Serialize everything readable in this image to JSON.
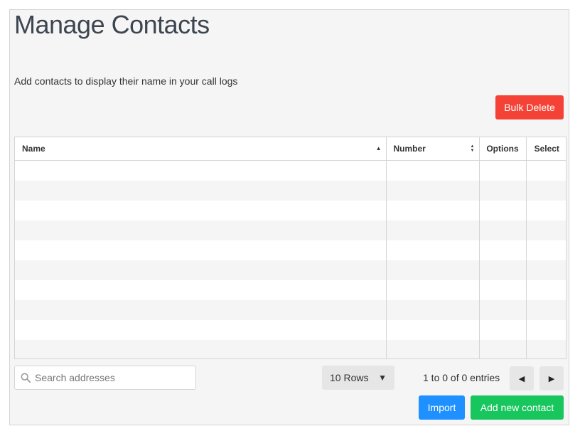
{
  "page": {
    "title": "Manage Contacts",
    "subtitle": "Add contacts to display their name in your call logs"
  },
  "actions": {
    "bulk_delete_label": "Bulk Delete",
    "import_label": "Import",
    "add_contact_label": "Add new contact"
  },
  "table": {
    "columns": [
      {
        "label": "Name",
        "sort": "ascending"
      },
      {
        "label": "Number",
        "sort": "sortable"
      },
      {
        "label": "Options",
        "sort": "none"
      },
      {
        "label": "Select",
        "sort": "none"
      }
    ],
    "rows": []
  },
  "footer": {
    "search_placeholder": "Search addresses",
    "search_value": "",
    "rows_per_page": "10 Rows",
    "entries_text": "1 to 0 of 0 entries"
  },
  "icons": {
    "search": "search-icon",
    "rows_caret": "caret-down-icon",
    "prev": "prev-page-icon",
    "next": "next-page-icon"
  },
  "colors": {
    "bulk_delete": "#f44336",
    "import": "#1e90ff",
    "add_contact": "#18c65e",
    "panel_background": "#f5f5f5"
  }
}
